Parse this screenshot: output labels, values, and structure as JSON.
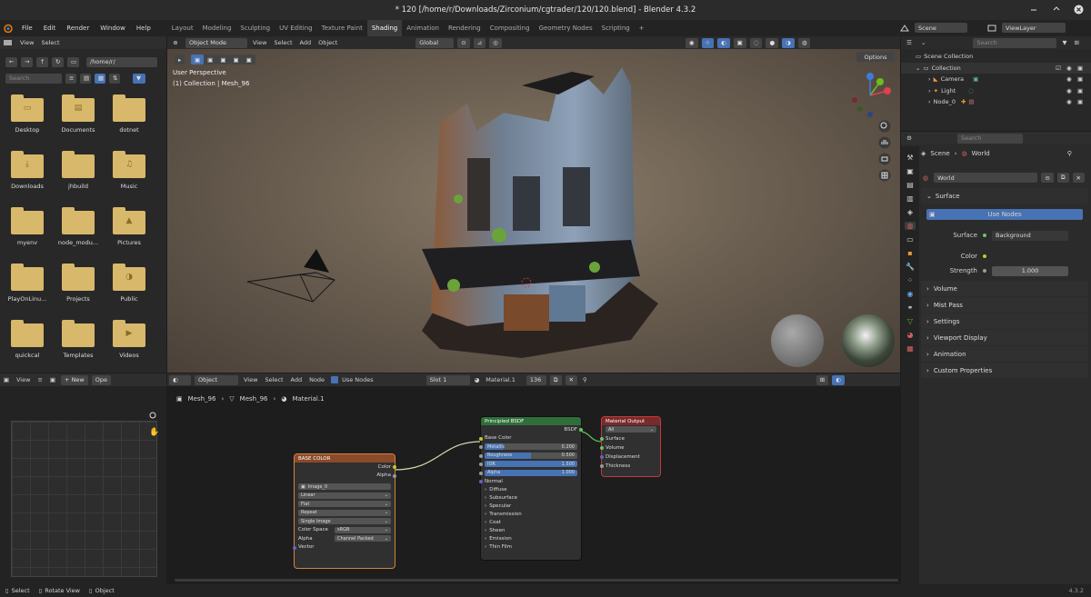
{
  "window": {
    "title": "* 120 [/home/r/Downloads/Zirconium/cgtrader/120/120.blend] - Blender 4.3.2"
  },
  "menu": [
    "File",
    "Edit",
    "Render",
    "Window",
    "Help"
  ],
  "workspaces": [
    "Layout",
    "Modeling",
    "Sculpting",
    "UV Editing",
    "Texture Paint",
    "Shading",
    "Animation",
    "Rendering",
    "Compositing",
    "Geometry Nodes",
    "Scripting"
  ],
  "scene": {
    "label": "Scene",
    "viewlayer": "ViewLayer"
  },
  "filebrowser": {
    "view": "View",
    "select": "Select",
    "path": "/home/r/",
    "search_placeholder": "Search",
    "folders": [
      "Desktop",
      "Documents",
      "dotnet",
      "Downloads",
      "jhbuild",
      "Music",
      "myenv",
      "node_modu...",
      "Pictures",
      "PlayOnLinu...",
      "Projects",
      "Public",
      "quickcal",
      "Templates",
      "Videos"
    ]
  },
  "viewport": {
    "mode": "Object Mode",
    "view": "View",
    "select": "Select",
    "add": "Add",
    "object": "Object",
    "transform": "Global",
    "options": "Options",
    "perspective": "User Perspective",
    "collection": "(1) Collection | Mesh_96"
  },
  "outliner": {
    "search": "Search",
    "items": [
      "Scene Collection",
      "Collection",
      "Camera",
      "Light",
      "Node_0"
    ]
  },
  "properties": {
    "search": "Search",
    "scene": "Scene",
    "world": "World",
    "world_field": "World",
    "surface_panel": "Surface",
    "use_nodes": "Use Nodes",
    "surface_label": "Surface",
    "surface_value": "Background",
    "color_label": "Color",
    "strength_label": "Strength",
    "strength_value": "1.000",
    "panels": [
      "Volume",
      "Mist Pass",
      "Settings",
      "Viewport Display",
      "Animation",
      "Custom Properties"
    ]
  },
  "image_editor": {
    "view": "View",
    "new": "New",
    "open": "Ope"
  },
  "node_editor": {
    "type": "Object",
    "view": "View",
    "select": "Select",
    "add": "Add",
    "node": "Node",
    "use_nodes": "Use Nodes",
    "slot": "Slot 1",
    "material": "Material.1",
    "users": "136",
    "breadcrumb": [
      "Mesh_96",
      "Mesh_96",
      "Material.1"
    ]
  },
  "node_base": {
    "title": "BASE COLOR",
    "out_color": "Color",
    "out_alpha": "Alpha",
    "image": "Image_0",
    "interp": "Linear",
    "proj": "Flat",
    "ext": "Repeat",
    "source": "Single Image",
    "cs_label": "Color Space",
    "cs_value": "sRGB",
    "alpha_label": "Alpha",
    "alpha_value": "Channel Packed",
    "vector": "Vector"
  },
  "node_bsdf": {
    "title": "Principled BSDF",
    "out": "BSDF",
    "base_color": "Base Color",
    "fields": [
      {
        "label": "Metallic",
        "value": "0.200",
        "fill": 0.2
      },
      {
        "label": "Roughness",
        "value": "0.500",
        "fill": 0.5
      },
      {
        "label": "IOR",
        "value": "1.500",
        "fill": 0
      },
      {
        "label": "Alpha",
        "value": "1.000",
        "fill": 1
      }
    ],
    "normal": "Normal",
    "panels": [
      "Diffuse",
      "Subsurface",
      "Specular",
      "Transmission",
      "Coat",
      "Sheen",
      "Emission",
      "Thin Film"
    ]
  },
  "node_output": {
    "title": "Material Output",
    "target": "All",
    "inputs": [
      "Surface",
      "Volume",
      "Displacement",
      "Thickness"
    ]
  },
  "status": {
    "select": "Select",
    "rotate": "Rotate View",
    "object": "Object",
    "version": "4.3.2"
  }
}
